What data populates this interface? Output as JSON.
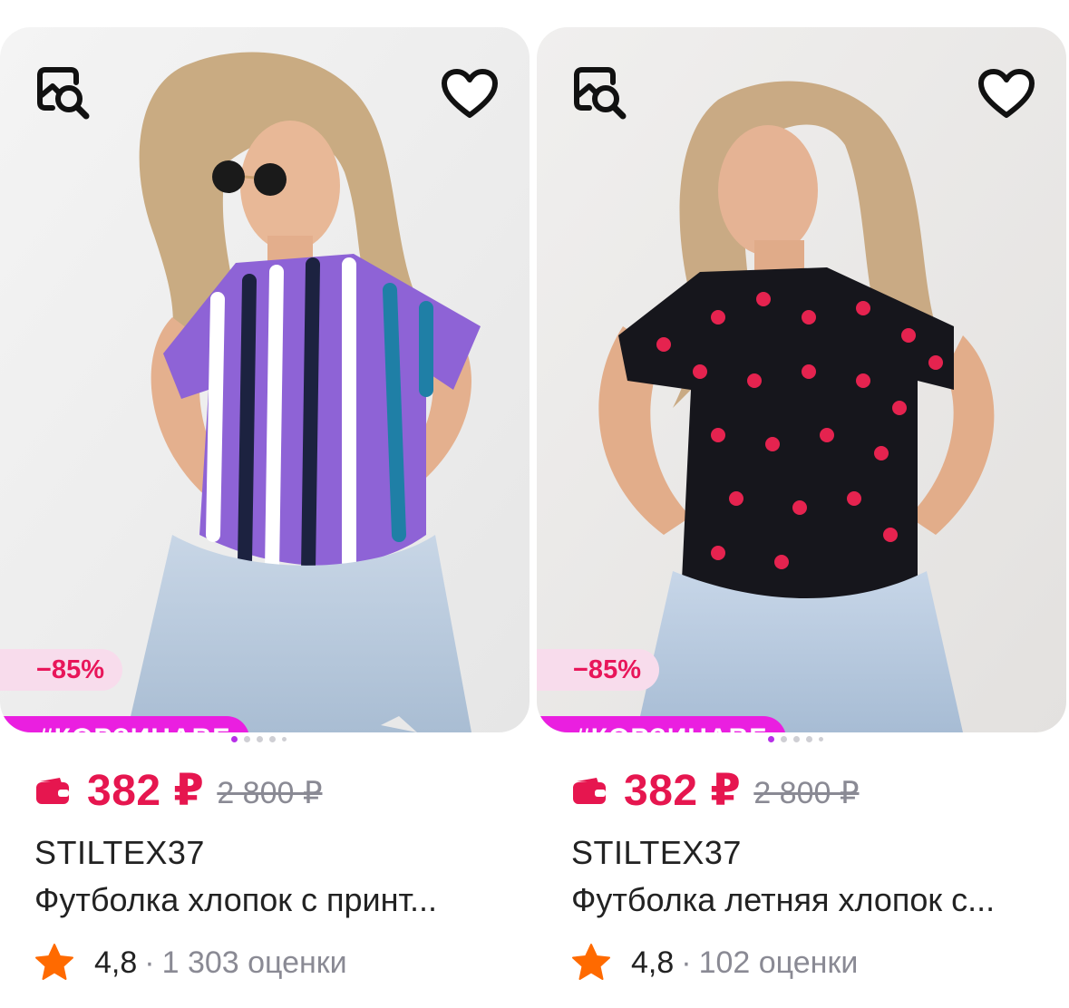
{
  "products": [
    {
      "discount": "−85%",
      "promo_tag": "#КОРЗИНАВБ",
      "price": "382 ₽",
      "old_price": "2 800 ₽",
      "brand": "STILTEX37",
      "title": "Футболка хлопок с принт...",
      "rating": "4,8",
      "separator": "·",
      "reviews": "1 303 оценки",
      "carousel_active": 1,
      "carousel_total": 5,
      "shirt_colors": [
        "#8e63d6",
        "#1f7fa6",
        "#ffffff",
        "#1c2240"
      ]
    },
    {
      "discount": "−85%",
      "promo_tag": "#КОРЗИНАВБ",
      "price": "382 ₽",
      "old_price": "2 800 ₽",
      "brand": "STILTEX37",
      "title": "Футболка летняя хлопок с...",
      "rating": "4,8",
      "separator": "·",
      "reviews": "102 оценки",
      "carousel_active": 1,
      "carousel_total": 5,
      "shirt_colors": [
        "#16161c",
        "#e5234f"
      ]
    }
  ],
  "icons": {
    "zoom": "image-search-icon",
    "favorite": "heart-outline-icon",
    "wallet": "wallet-icon",
    "star": "star-icon"
  },
  "colors": {
    "price": "#e6164f",
    "promo": "#ea1fe0",
    "discount_bg": "#f8dcec",
    "star": "#ff6a00",
    "muted": "#8a8a94"
  }
}
